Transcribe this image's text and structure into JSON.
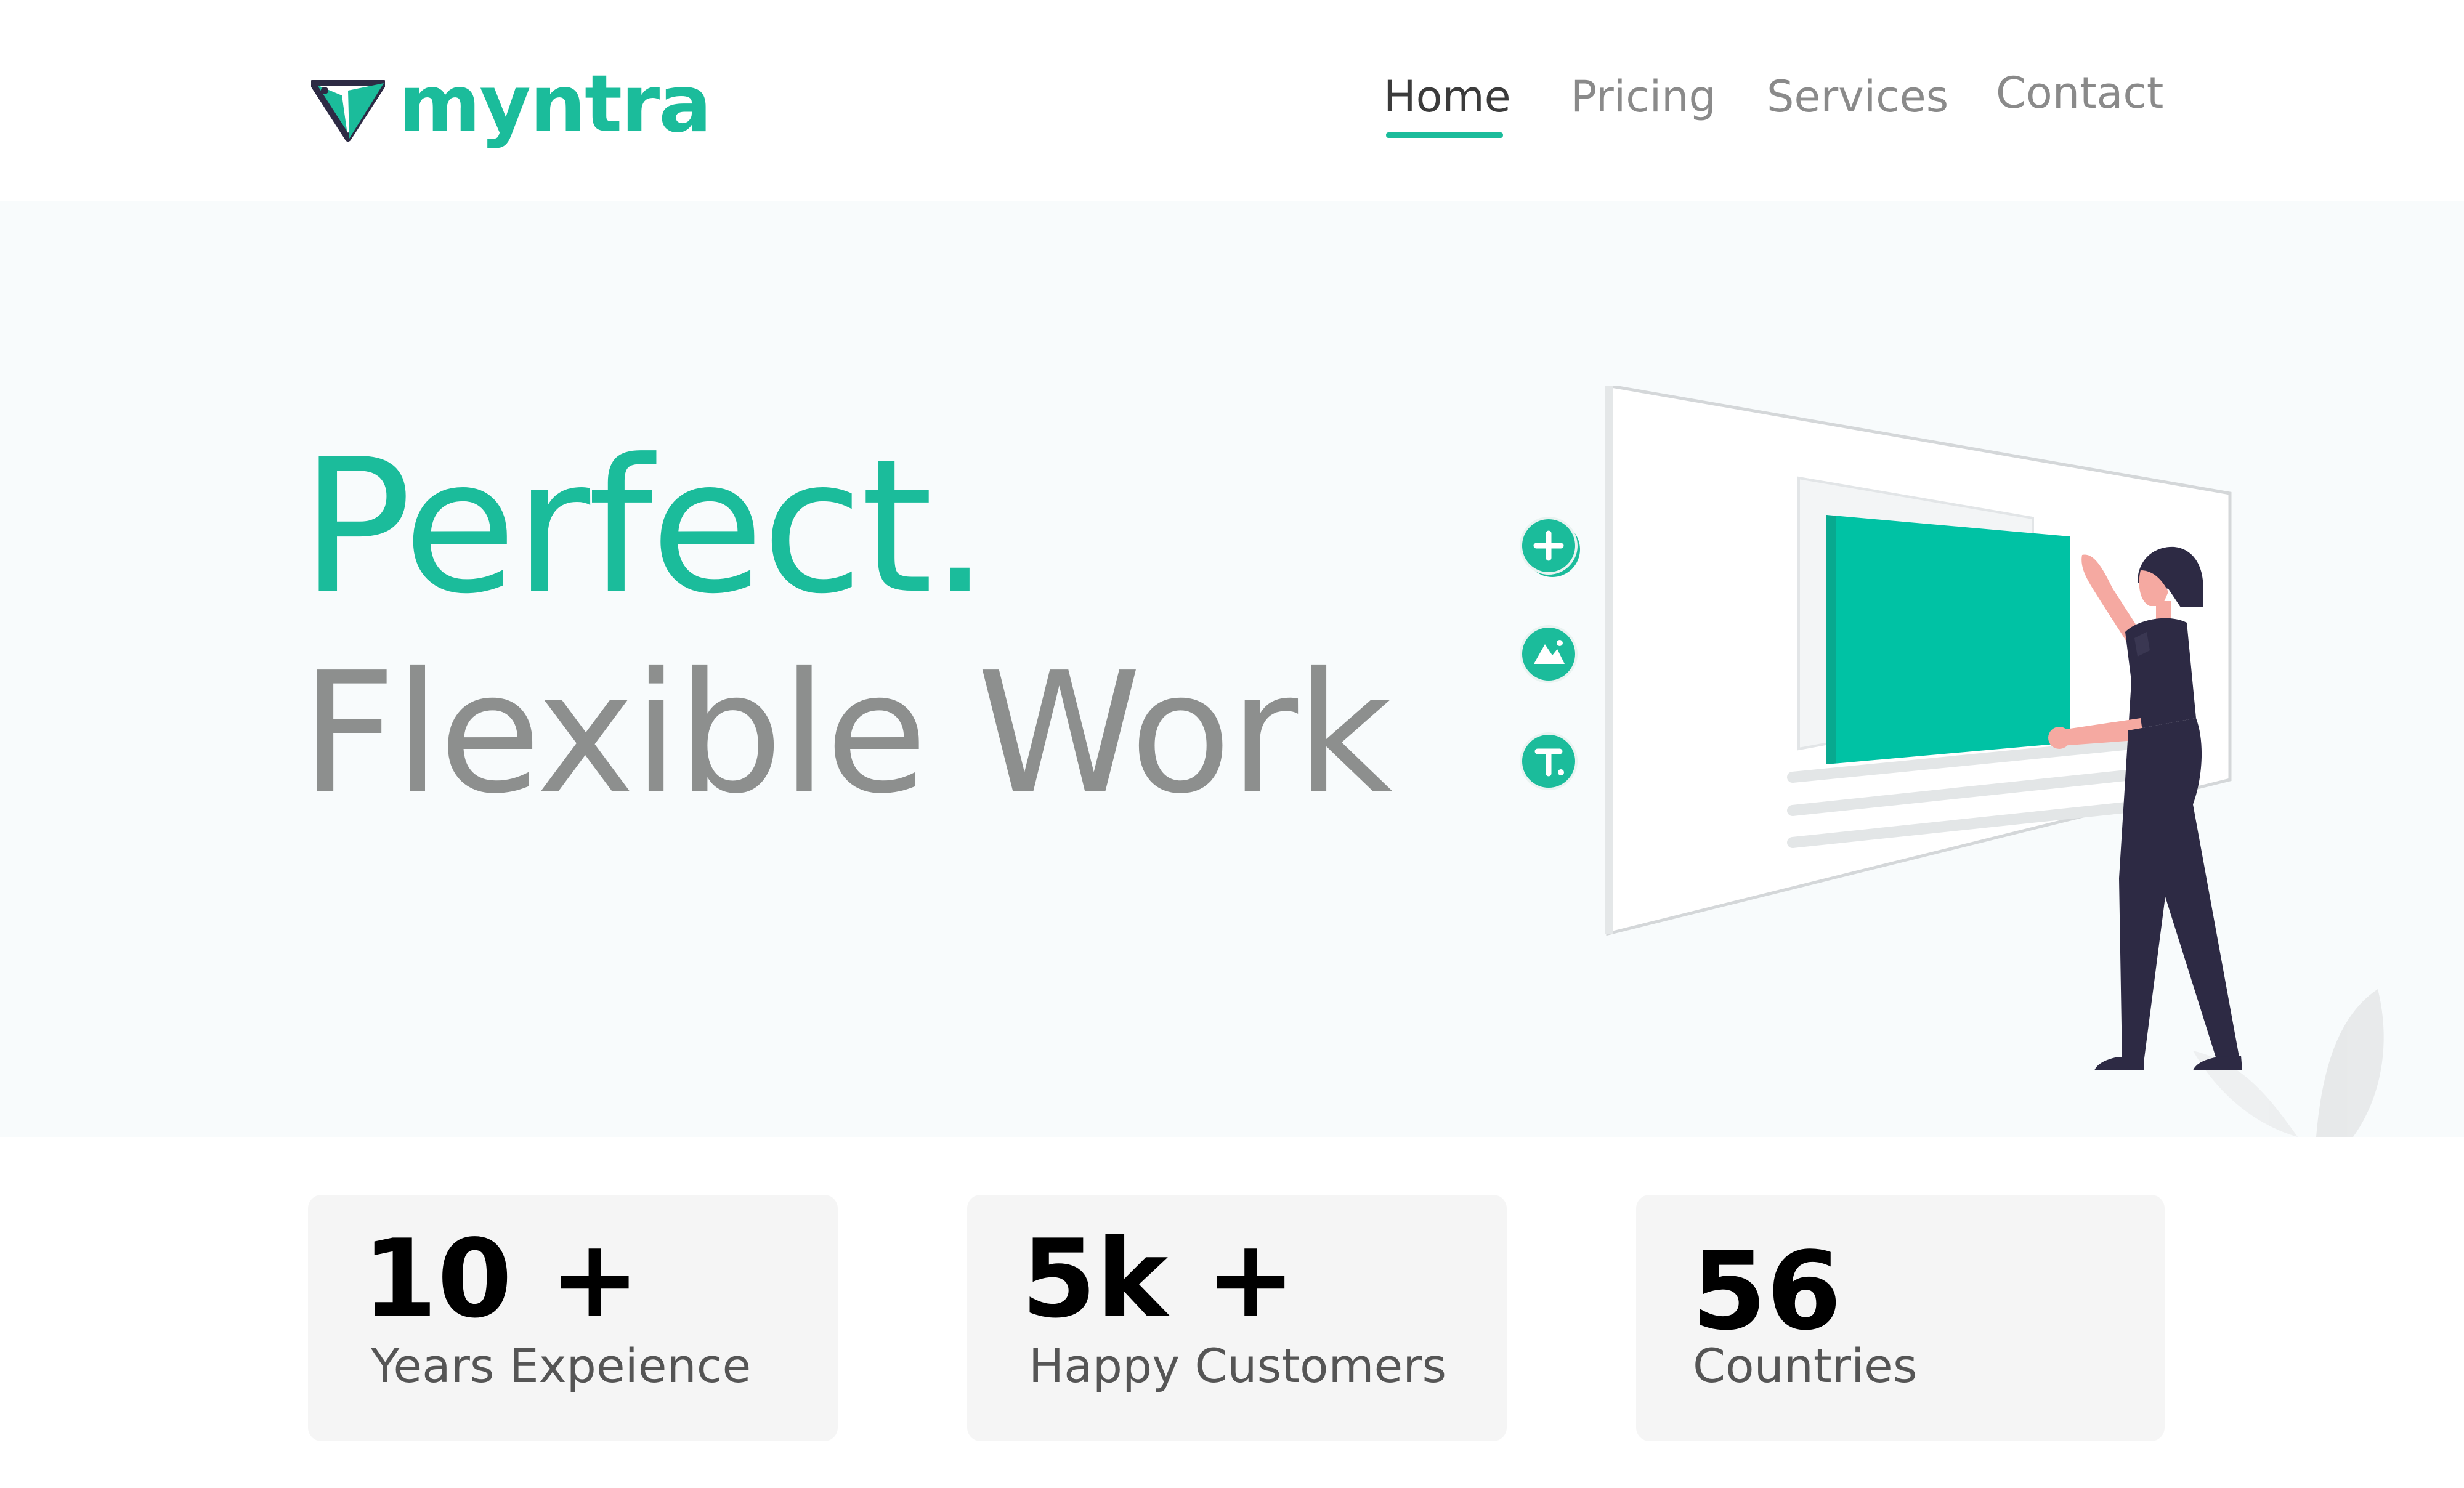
{
  "brand": {
    "name": "myntra",
    "color": "#1bbc9b",
    "dark_color": "#2d2a44"
  },
  "nav": {
    "items": [
      {
        "label": "Home",
        "active": true
      },
      {
        "label": "Pricing",
        "active": false
      },
      {
        "label": "Services",
        "active": false
      },
      {
        "label": "Contact",
        "active": false
      }
    ]
  },
  "hero": {
    "title": "Perfect.",
    "subtitle": "Flexible Work",
    "tool_icons": [
      "plus-icon",
      "image-icon",
      "text-icon"
    ]
  },
  "stats": [
    {
      "value": "10 +",
      "label": "Years Expeience"
    },
    {
      "value": "5k +",
      "label": "Happy Customers"
    },
    {
      "value": "56",
      "label": "Countries"
    }
  ],
  "colors": {
    "accent": "#1bbc9b",
    "hero_bg": "#f8fbfc",
    "card_bg": "#f5f5f5",
    "muted_text": "#8d8f8e"
  }
}
